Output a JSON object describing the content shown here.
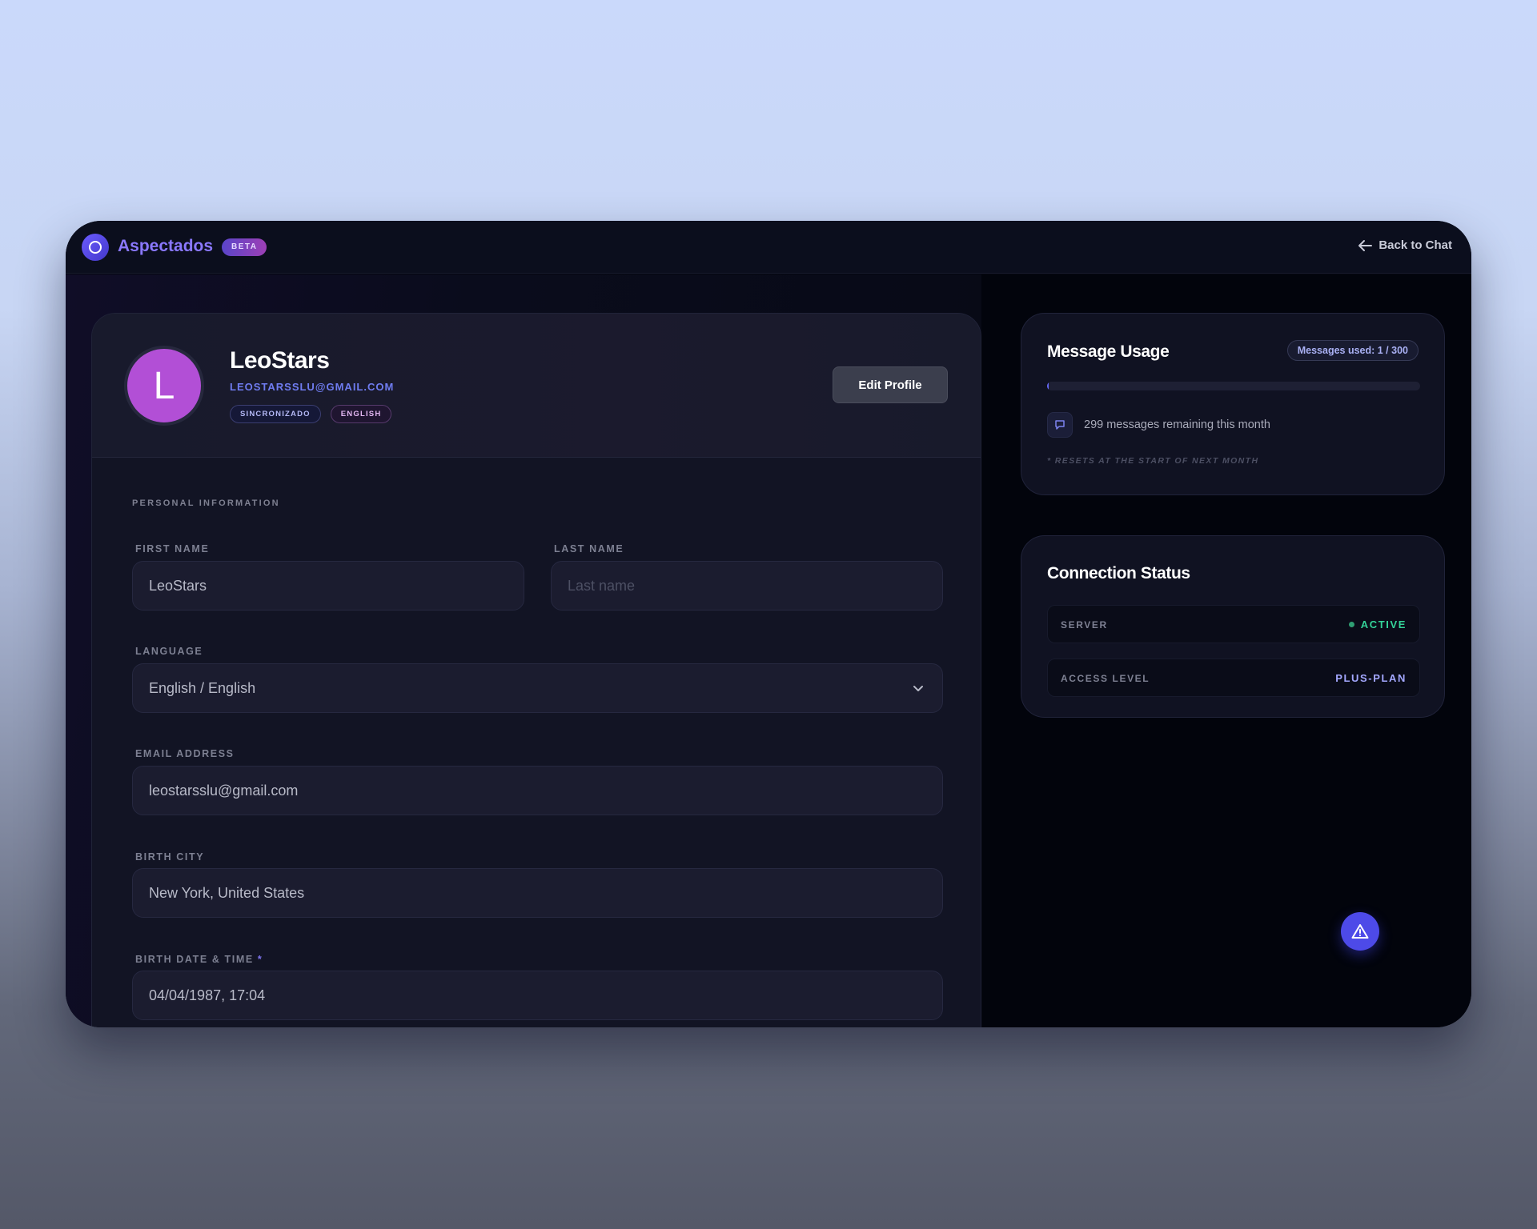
{
  "header": {
    "brand": "Aspectados",
    "beta_badge": "BETA",
    "back_label": "Back to Chat"
  },
  "profile": {
    "avatar_letter": "L",
    "name": "LeoStars",
    "email": "LEOSTARSSLU@GMAIL.COM",
    "tags": [
      "SINCRONIZADO",
      "ENGLISH"
    ],
    "edit_label": "Edit Profile"
  },
  "form": {
    "section_title": "PERSONAL INFORMATION",
    "first_name": {
      "label": "FIRST NAME",
      "value": "LeoStars",
      "placeholder": ""
    },
    "last_name": {
      "label": "LAST NAME",
      "value": "",
      "placeholder": "Last name"
    },
    "language": {
      "label": "LANGUAGE",
      "value": "English / English"
    },
    "email": {
      "label": "EMAIL ADDRESS",
      "value": "leostarsslu@gmail.com"
    },
    "birth_city": {
      "label": "BIRTH CITY",
      "value": "New York, United States"
    },
    "birth_datetime": {
      "label": "BIRTH DATE & TIME",
      "required_mark": "*",
      "value": "04/04/1987, 17:04"
    }
  },
  "usage": {
    "title": "Message Usage",
    "badge": "Messages used: 1 / 300",
    "used": 1,
    "limit": 300,
    "remaining_text": "299 messages remaining this month",
    "reset_note": "* RESETS AT THE START OF NEXT MONTH"
  },
  "connection": {
    "title": "Connection Status",
    "server_label": "SERVER",
    "server_value": "ACTIVE",
    "access_label": "ACCESS LEVEL",
    "access_value": "PLUS-PLAN"
  },
  "colors": {
    "accent": "#6366f1",
    "brand": "#8a78ff",
    "active": "#34d399",
    "avatar": "#b24fd6"
  },
  "icons": {
    "logo": "logo-ring-icon",
    "back": "arrow-left-icon",
    "chevron": "chevron-down-icon",
    "chat": "chat-bubble-icon",
    "fab": "warning-triangle-icon"
  }
}
